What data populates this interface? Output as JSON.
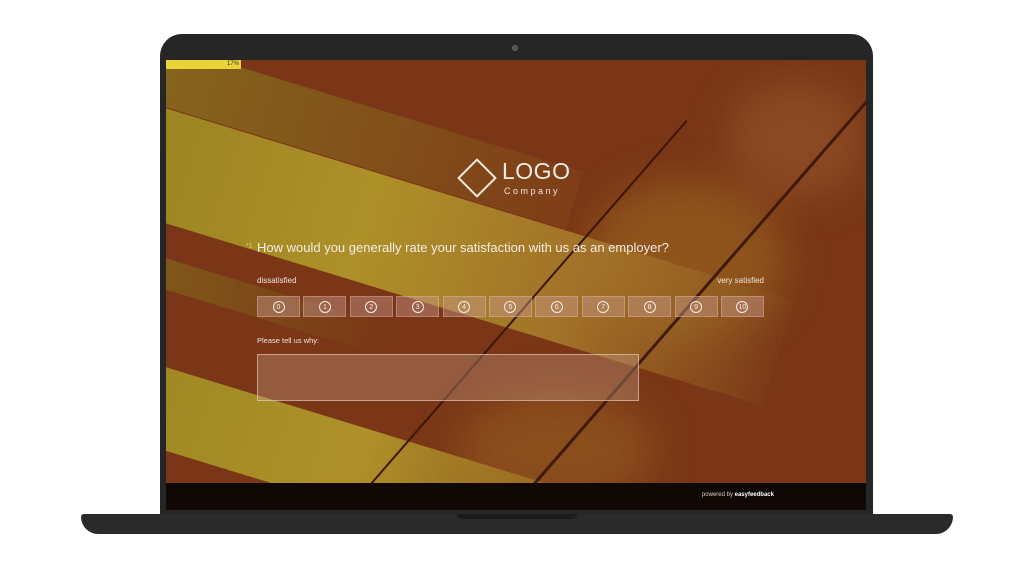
{
  "progress": {
    "label": "17%",
    "value_percent": 17,
    "color": "#e9d23a"
  },
  "logo": {
    "text": "LOGO",
    "subtitle": "Company"
  },
  "question": {
    "required_marker": "*1",
    "text": "How would you generally rate your satisfaction with us as an employer?",
    "low_label": "dissatisfied",
    "high_label": "very satisfied",
    "scale": [
      "0",
      "1",
      "2",
      "3",
      "4",
      "5",
      "6",
      "7",
      "8",
      "9",
      "10"
    ]
  },
  "comment": {
    "label": "Please tell us why:",
    "value": "",
    "placeholder": ""
  },
  "footer": {
    "powered_prefix": "powered by",
    "brand": "easyfeedback"
  },
  "colors": {
    "accent": "#e9d23a",
    "background": "#7a3616",
    "footer": "#0f0805"
  }
}
